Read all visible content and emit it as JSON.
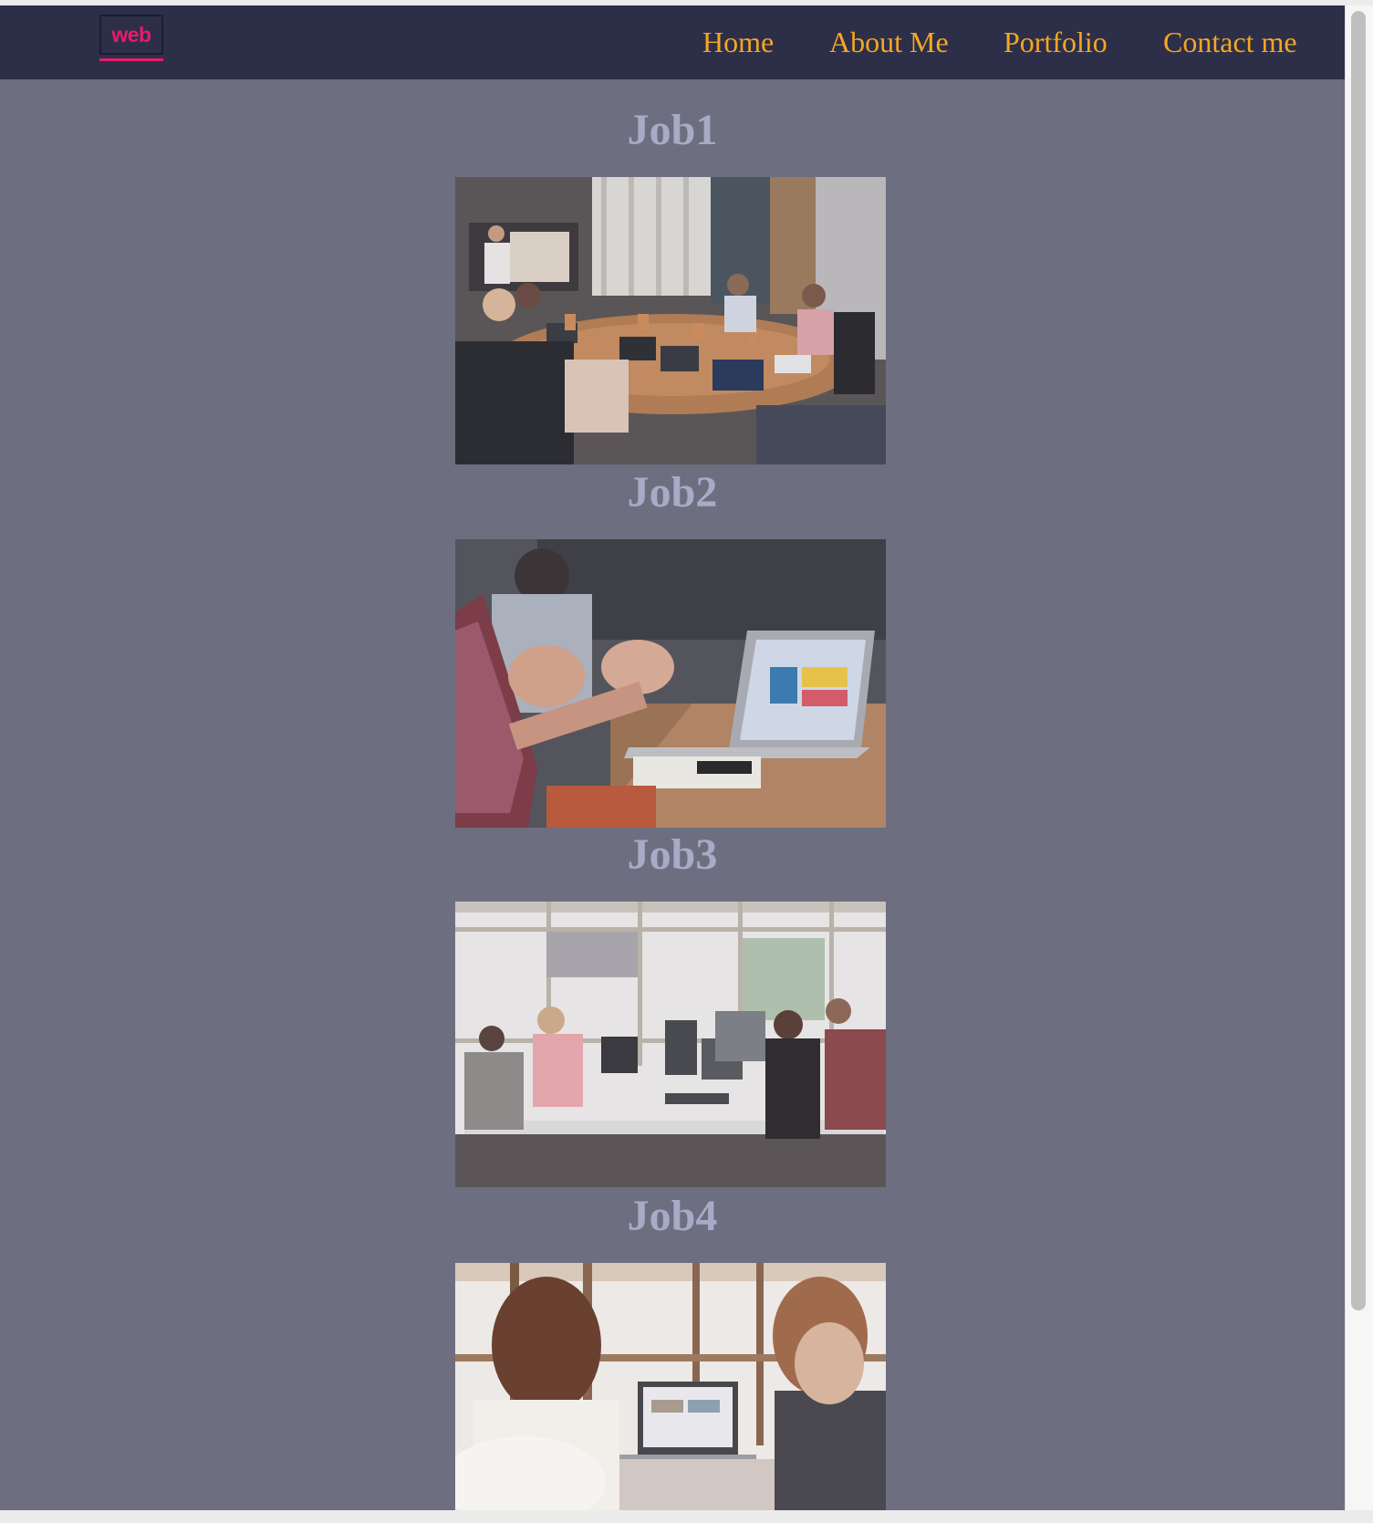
{
  "header": {
    "logo_text": "web",
    "nav": [
      "Home",
      "About Me",
      "Portfolio",
      "Contact me"
    ]
  },
  "jobs": [
    {
      "title": "Job1",
      "image": "team meeting around conference table with laptops"
    },
    {
      "title": "Job2",
      "image": "hands gesturing near laptop on wooden desk"
    },
    {
      "title": "Job3",
      "image": "people working at computers in bright office"
    },
    {
      "title": "Job4",
      "image": "two women looking at a laptop by window"
    }
  ],
  "colors": {
    "navbar": "#2d2f48",
    "nav_link": "#f5a623",
    "logo_accent": "#e81b6b",
    "page_background": "#6d6f80",
    "job_title": "#a8abc6"
  }
}
